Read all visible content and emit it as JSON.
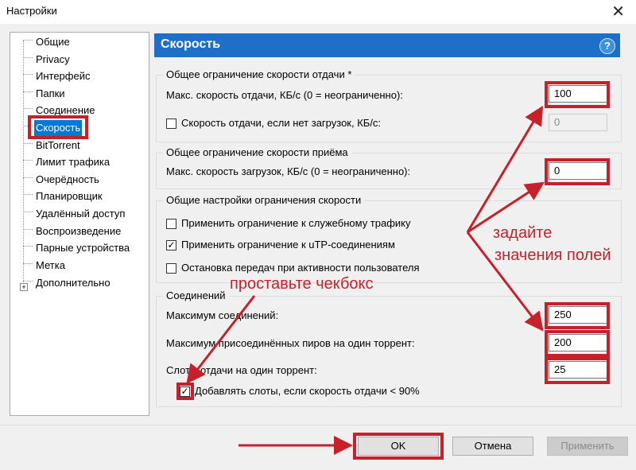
{
  "window": {
    "title": "Настройки",
    "close_symbol": "✕"
  },
  "sidebar": {
    "items": [
      {
        "label": "Общие"
      },
      {
        "label": "Privacy"
      },
      {
        "label": "Интерфейс"
      },
      {
        "label": "Папки"
      },
      {
        "label": "Соединение"
      },
      {
        "label": "Скорость",
        "selected": true
      },
      {
        "label": "BitTorrent"
      },
      {
        "label": "Лимит трафика"
      },
      {
        "label": "Очерёдность"
      },
      {
        "label": "Планировщик"
      },
      {
        "label": "Удалённый доступ"
      },
      {
        "label": "Воспроизведение"
      },
      {
        "label": "Парные устройства"
      },
      {
        "label": "Метка"
      },
      {
        "label": "Дополнительно",
        "expandable": true
      }
    ]
  },
  "panel": {
    "title": "Скорость",
    "help_symbol": "?",
    "upload_group": {
      "title": "Общее ограничение скорости отдачи *",
      "max_upload_label": "Макс. скорость отдачи, КБ/с (0 = неограниченно):",
      "max_upload_value": "100",
      "no_download_label": "Скорость отдачи, если нет загрузок, КБ/с:",
      "no_download_checked": false,
      "no_download_value": "0"
    },
    "download_group": {
      "title": "Общее ограничение скорости приёма",
      "max_download_label": "Макс. скорость загрузок, КБ/с (0 = неограниченно):",
      "max_download_value": "0"
    },
    "general_group": {
      "title": "Общие настройки ограничения скорости",
      "service_traffic_label": "Применить ограничение к служебному трафику",
      "service_traffic_checked": false,
      "utp_label": "Применить ограничение к uTP-соединениям",
      "utp_checked": true,
      "user_active_label": "Остановка передач при активности пользователя",
      "user_active_checked": false
    },
    "connections_group": {
      "title": "Соединений",
      "max_connections_label": "Максимум соединений:",
      "max_connections_value": "250",
      "max_peers_label": "Максимум присоединённых пиров на один торрент:",
      "max_peers_value": "200",
      "upload_slots_label": "Слоты отдачи на один торрент:",
      "upload_slots_value": "25",
      "add_slots_label": "Добавлять слоты, если скорость отдачи < 90%",
      "add_slots_checked": true
    }
  },
  "annotations": {
    "checkbox_hint": "проставьте чекбокс",
    "fields_hint_line1": "задайте",
    "fields_hint_line2": "значения полей",
    "color": "#c8202b"
  },
  "buttons": {
    "ok": "OK",
    "cancel": "Отмена",
    "apply": "Применить"
  },
  "icons": {
    "check": "✓",
    "expand": "+"
  }
}
